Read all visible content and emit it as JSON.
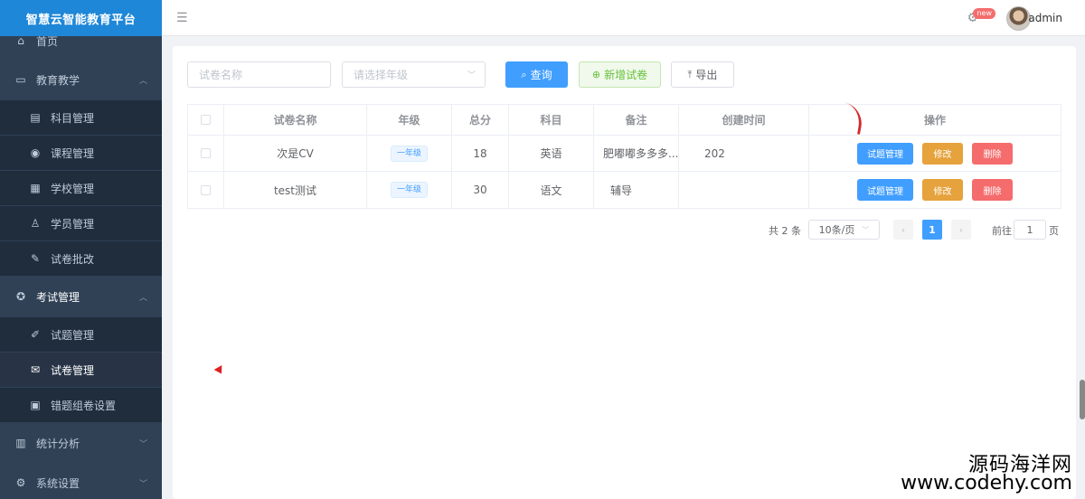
{
  "app": {
    "title": "智慧云智能教育平台"
  },
  "header": {
    "badge": "new",
    "user": "admin"
  },
  "sidebar": {
    "items": [
      {
        "label": "首页",
        "icon": "home-icon"
      },
      {
        "label": "教育教学",
        "icon": "book-icon",
        "expanded": true
      },
      {
        "label": "科目管理",
        "icon": "briefcase-icon"
      },
      {
        "label": "课程管理",
        "icon": "eye-icon"
      },
      {
        "label": "学校管理",
        "icon": "school-icon"
      },
      {
        "label": "学员管理",
        "icon": "student-icon"
      },
      {
        "label": "试卷批改",
        "icon": "grade-icon"
      },
      {
        "label": "考试管理",
        "icon": "exam-icon",
        "expanded": true
      },
      {
        "label": "试题管理",
        "icon": "edit-icon"
      },
      {
        "label": "试卷管理",
        "icon": "paper-icon",
        "active": true
      },
      {
        "label": "错题组卷设置",
        "icon": "error-icon"
      },
      {
        "label": "统计分析",
        "icon": "chart-icon"
      },
      {
        "label": "系统设置",
        "icon": "settings-icon"
      }
    ]
  },
  "filters": {
    "name_placeholder": "试卷名称",
    "grade_placeholder": "请选择年级",
    "search_label": "查询",
    "add_label": "新增试卷",
    "export_label": "导出"
  },
  "table": {
    "headers": [
      "试卷名称",
      "年级",
      "总分",
      "科目",
      "备注",
      "创建时间",
      "操作"
    ],
    "rows": [
      {
        "name": "次是CV",
        "grade": "一年级",
        "score": "18",
        "subject": "英语",
        "remark": "肥嘟嘟多多多...",
        "created": "202"
      },
      {
        "name": "test测试",
        "grade": "一年级",
        "score": "30",
        "subject": "语文",
        "remark": "辅导",
        "created": ""
      }
    ],
    "actions": {
      "questions": "试题管理",
      "edit": "修改",
      "delete": "删除"
    }
  },
  "pagination": {
    "total": "共 2 条",
    "page_size": "10条/页",
    "current": "1",
    "goto_prefix": "前往",
    "goto_value": "1",
    "goto_suffix": "页"
  },
  "watermark": {
    "line1": "源码海洋网",
    "line2": "www.codehy.com"
  },
  "colors": {
    "primary": "#409eff",
    "warning": "#e6a23c",
    "danger": "#f56c6c",
    "sidebar": "#304156"
  }
}
